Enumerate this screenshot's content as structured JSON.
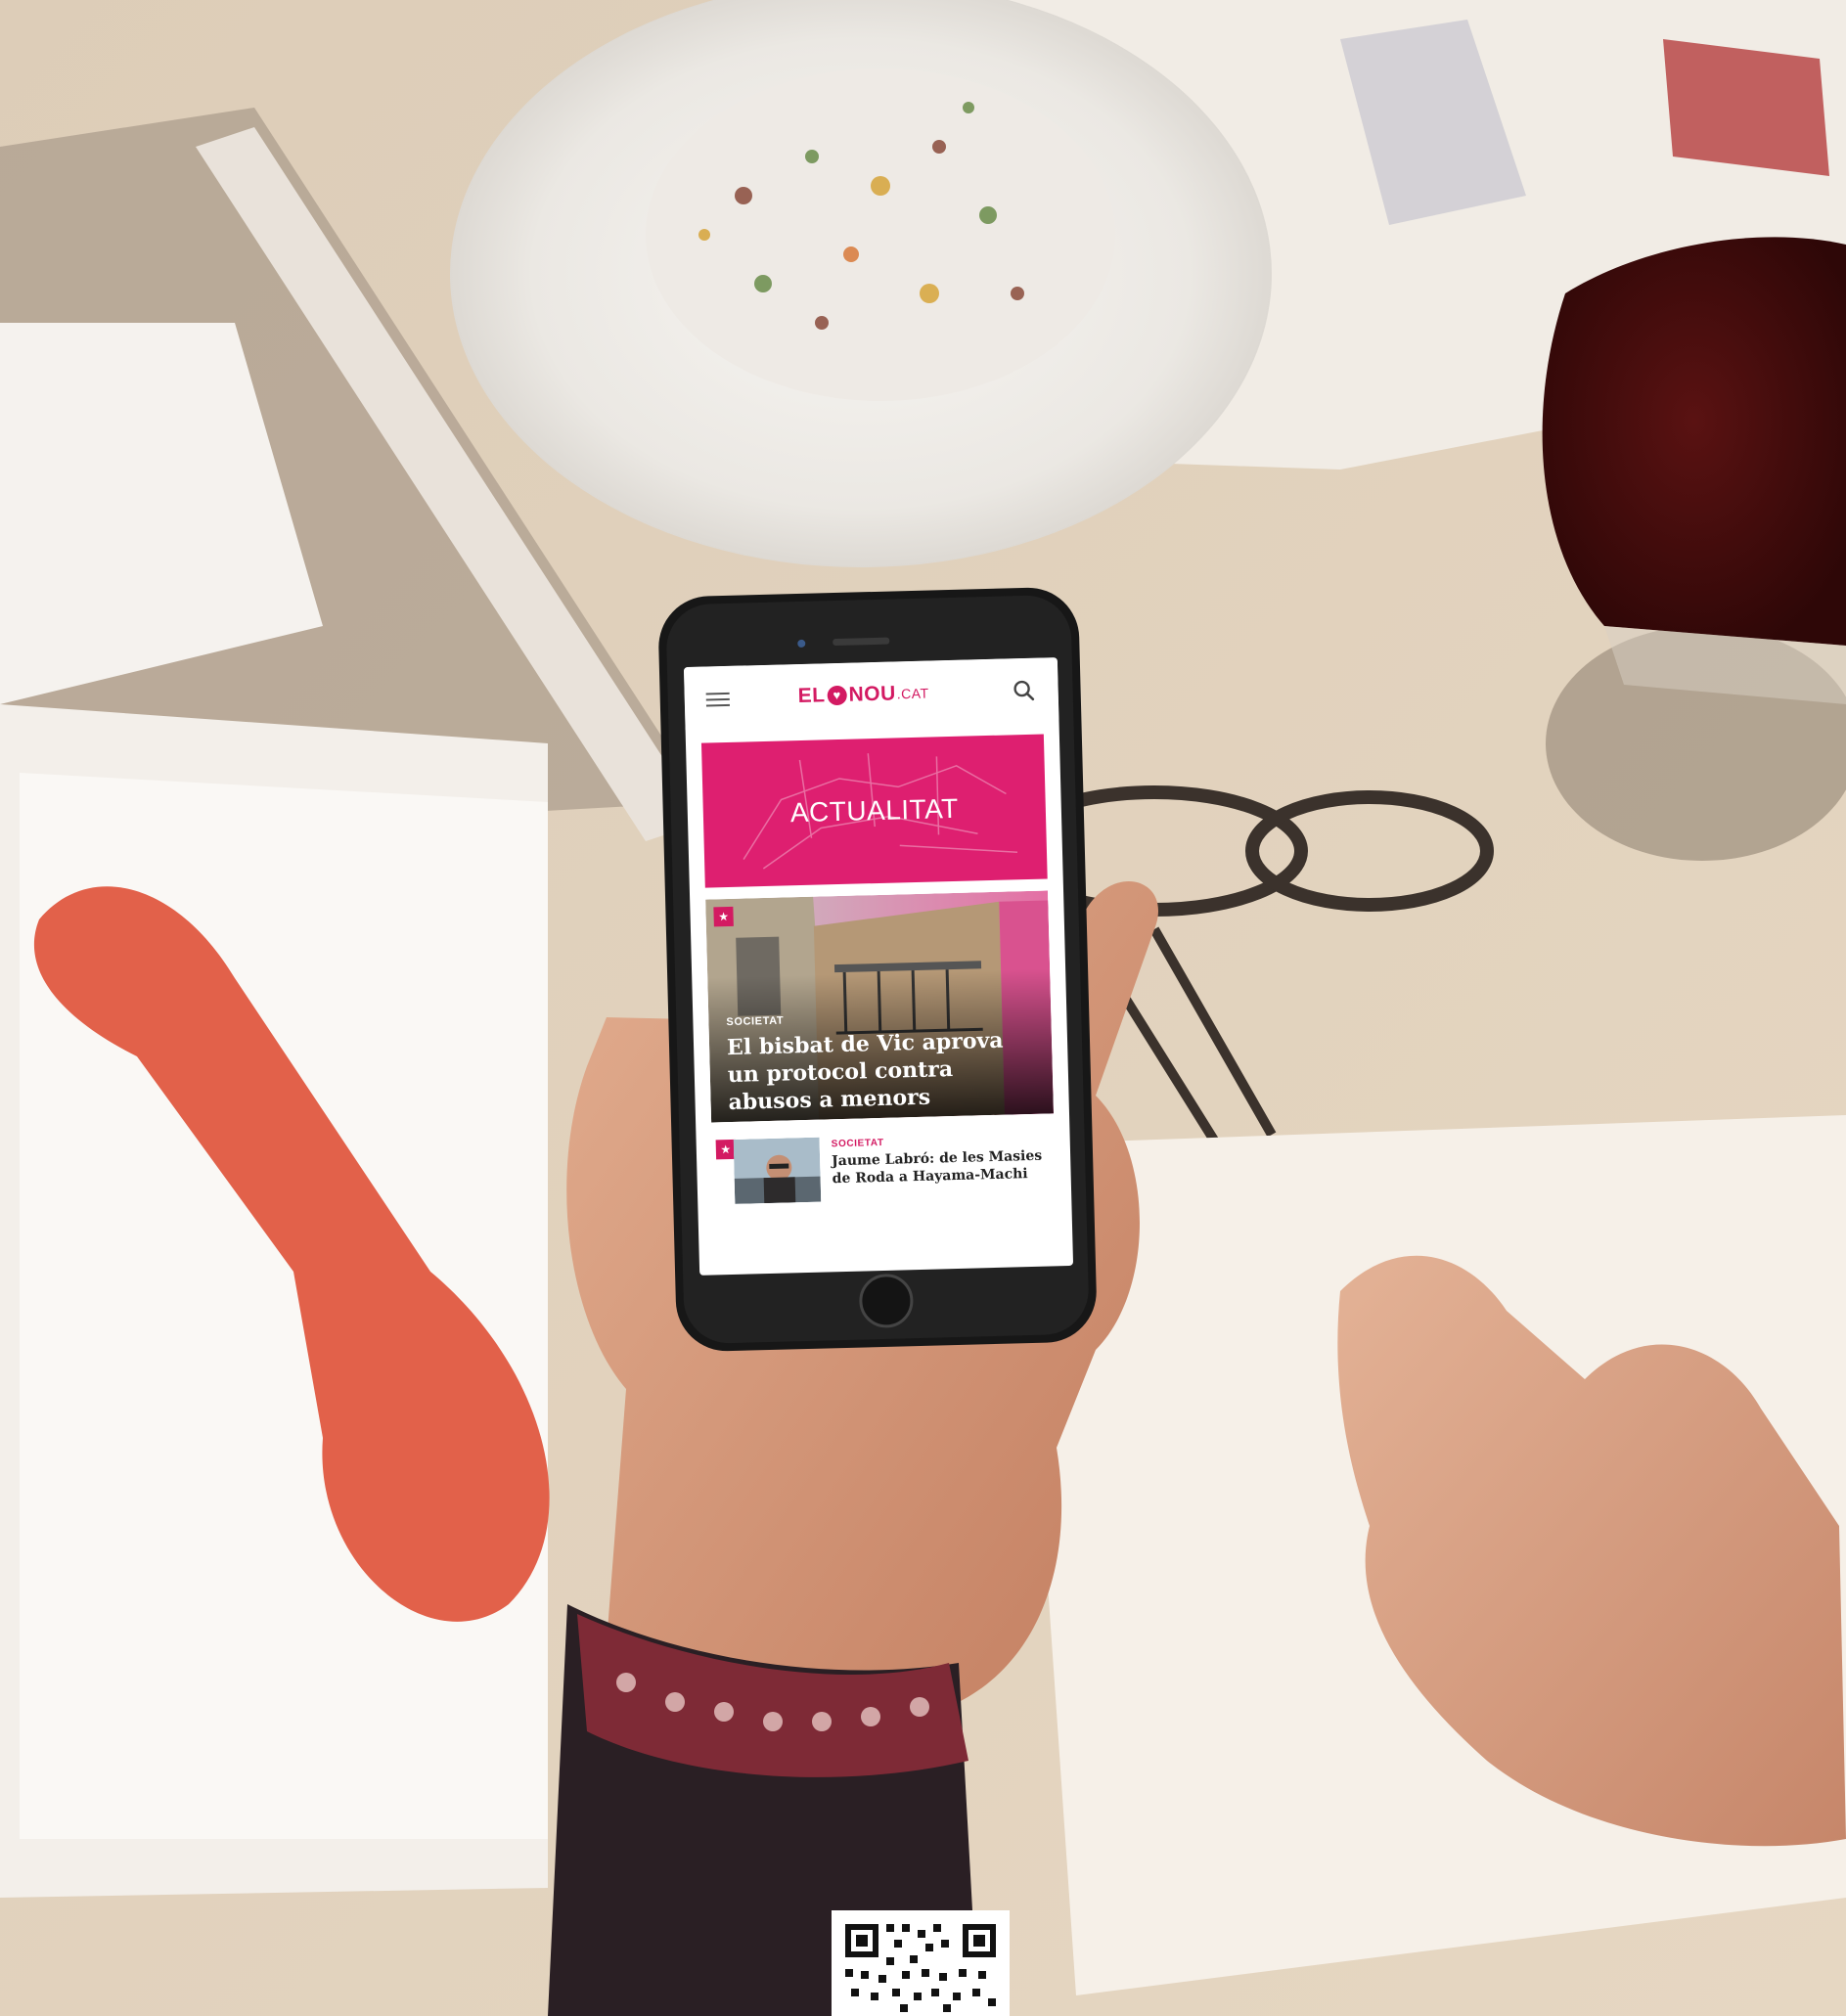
{
  "app": {
    "logo": {
      "part1": "EL",
      "heart": "♥",
      "part2": "NOU",
      "part3": ".CAT"
    }
  },
  "banner": {
    "title": "ACTUALITAT"
  },
  "featured": {
    "category": "SOCIETAT",
    "headline": "El bisbat de Vic aprova un protocol contra abusos a menors",
    "badge_icon": "star-icon"
  },
  "list": [
    {
      "category": "SOCIETAT",
      "headline": "Jaume Labró: de les Masies de Roda a Hayama-Machi",
      "badge_icon": "star-icon"
    }
  ],
  "colors": {
    "brand": "#d31a62",
    "banner": "#de1f70",
    "text_dark": "#222222"
  },
  "icons": {
    "menu": "hamburger-icon",
    "search": "search-icon",
    "badge": "star-icon",
    "qr": "qr-code-icon"
  }
}
